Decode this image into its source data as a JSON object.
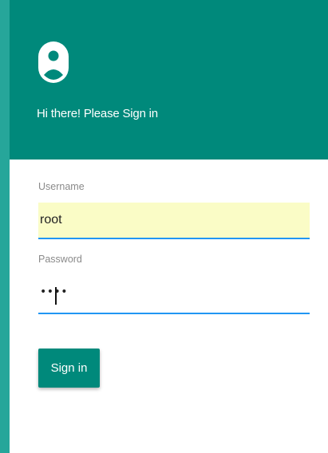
{
  "header": {
    "icon": "account-circle-icon",
    "greeting": "Hi there! Please Sign in"
  },
  "form": {
    "username_label": "Username",
    "username_value": "root",
    "password_label": "Password",
    "password_display": "••••",
    "submit_label": "Sign in"
  },
  "colors": {
    "background": "#26a69a",
    "header": "#00897b",
    "button": "#00897b",
    "autofill": "#fafcc6",
    "focus_underline": "#2196f3"
  }
}
